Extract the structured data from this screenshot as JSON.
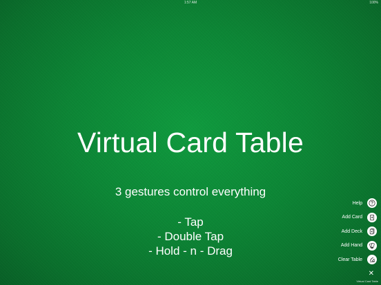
{
  "status": {
    "left": "",
    "time": "1:57 AM",
    "right": "100%"
  },
  "title": "Virtual Card Table",
  "subtitle": "3 gestures control everything",
  "gestures": [
    "- Tap",
    "- Double Tap",
    "- Hold - n - Drag"
  ],
  "menu": {
    "items": [
      {
        "label": "Help",
        "icon": "question-icon"
      },
      {
        "label": "Add Card",
        "icon": "card-icon"
      },
      {
        "label": "Add Deck",
        "icon": "deck-icon"
      },
      {
        "label": "Add Hand",
        "icon": "hand-icon"
      },
      {
        "label": "Clear Table",
        "icon": "clear-icon"
      }
    ],
    "close": "✕",
    "footer": "Virtual Card Table"
  },
  "colors": {
    "felt": "#0c8535",
    "text": "#ffffff"
  }
}
